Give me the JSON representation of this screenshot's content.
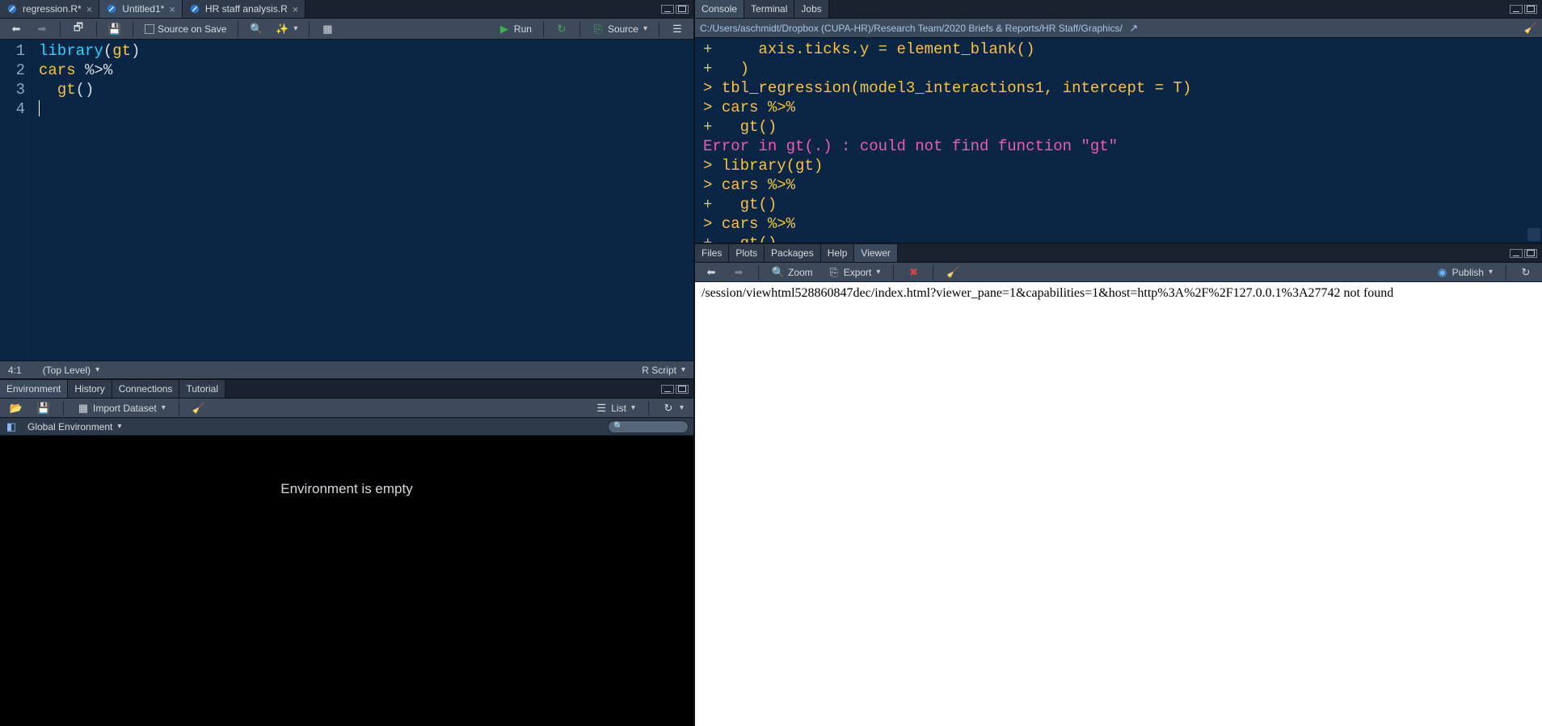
{
  "editor": {
    "tabs": [
      {
        "label": "regression.R*",
        "active": false
      },
      {
        "label": "Untitled1*",
        "active": true
      },
      {
        "label": "HR staff analysis.R",
        "active": false
      }
    ],
    "toolbar": {
      "source_on_save": "Source on Save",
      "run": "Run",
      "source": "Source"
    },
    "lines": [
      {
        "n": "1",
        "html": "<span class='kw'>library</span><span class='op'>(</span><span class='fn'>gt</span><span class='op'>)</span>"
      },
      {
        "n": "2",
        "html": "<span class='fn'>cars</span> <span class='op'>%&gt;%</span>"
      },
      {
        "n": "3",
        "html": "  <span class='fn'>gt</span><span class='op'>()</span>"
      },
      {
        "n": "4",
        "html": "<span class='cursor'></span>"
      }
    ],
    "status": {
      "pos": "4:1",
      "scope": "(Top Level)",
      "lang": "R Script"
    }
  },
  "env": {
    "tabs": [
      "Environment",
      "History",
      "Connections",
      "Tutorial"
    ],
    "active": 0,
    "import": "Import Dataset",
    "list": "List",
    "scope": "Global Environment",
    "empty": "Environment is empty"
  },
  "console": {
    "tabs": [
      "Console",
      "Terminal",
      "Jobs"
    ],
    "active": 0,
    "path": "C:/Users/aschmidt/Dropbox (CUPA-HR)/Research Team/2020 Briefs & Reports/HR Staff/Graphics/",
    "lines": [
      {
        "t": "cont",
        "text": "+     axis.ticks.y = element_blank()"
      },
      {
        "t": "cont",
        "text": "+   )"
      },
      {
        "t": "prompt",
        "text": "> ",
        "rest": "tbl_regression(model3_interactions1, intercept = T)"
      },
      {
        "t": "prompt",
        "text": "> ",
        "rest": "cars %>%"
      },
      {
        "t": "cont",
        "text": "+   gt()"
      },
      {
        "t": "err",
        "text": "Error in gt(.) : could not find function \"gt\""
      },
      {
        "t": "prompt",
        "text": "> ",
        "rest": "library(gt)"
      },
      {
        "t": "prompt",
        "text": "> ",
        "rest": "cars %>%"
      },
      {
        "t": "cont",
        "text": "+   gt()"
      },
      {
        "t": "prompt",
        "text": "> ",
        "rest": "cars %>%"
      },
      {
        "t": "cont",
        "text": "+   gt()"
      },
      {
        "t": "prompt",
        "text": "> ",
        "rest": ""
      }
    ]
  },
  "viewer": {
    "tabs": [
      "Files",
      "Plots",
      "Packages",
      "Help",
      "Viewer"
    ],
    "active": 4,
    "zoom": "Zoom",
    "export": "Export",
    "publish": "Publish",
    "body": "/session/viewhtml528860847dec/index.html?viewer_pane=1&capabilities=1&host=http%3A%2F%2F127.0.0.1%3A27742 not found"
  }
}
